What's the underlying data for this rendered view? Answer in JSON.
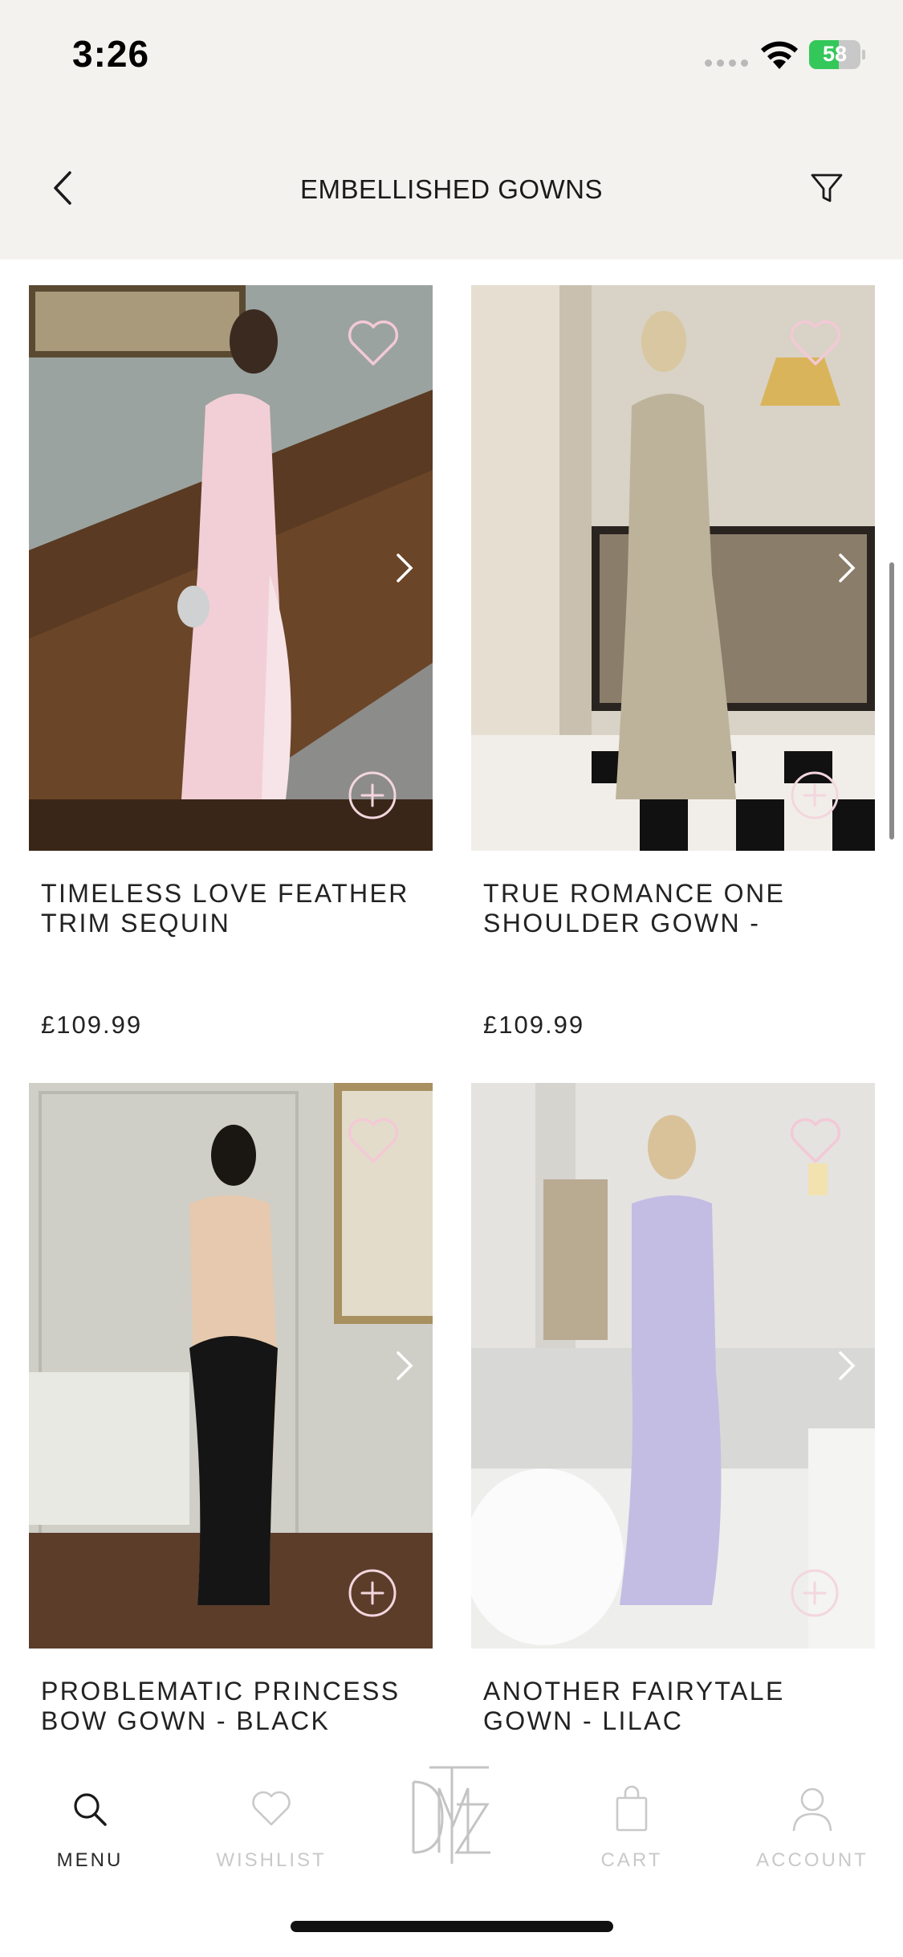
{
  "status_bar": {
    "time": "3:26",
    "battery": "58",
    "battery_level": 0.58
  },
  "header": {
    "title": "EMBELLISHED GOWNS"
  },
  "products": [
    {
      "name": "TIMELESS LOVE FEATHER TRIM SEQUIN",
      "price": "£109.99"
    },
    {
      "name": "TRUE ROMANCE ONE SHOULDER GOWN -",
      "price": "£109.99"
    },
    {
      "name": "PROBLEMATIC PRINCESS BOW GOWN - BLACK",
      "price": ""
    },
    {
      "name": "ANOTHER FAIRYTALE GOWN - LILAC",
      "price": ""
    }
  ],
  "tabs": [
    {
      "label": "MENU",
      "icon": "search-icon",
      "active": true
    },
    {
      "label": "WISHLIST",
      "icon": "heart-icon",
      "active": false
    },
    {
      "label": "",
      "icon": "brand-logo",
      "active": false
    },
    {
      "label": "CART",
      "icon": "shopping-bag-icon",
      "active": false
    },
    {
      "label": "ACCOUNT",
      "icon": "user-icon",
      "active": false
    }
  ],
  "colors": {
    "header_bg": "#f3f2ef",
    "accent_pink": "#f3c9d6",
    "battery_green": "#34c759"
  }
}
